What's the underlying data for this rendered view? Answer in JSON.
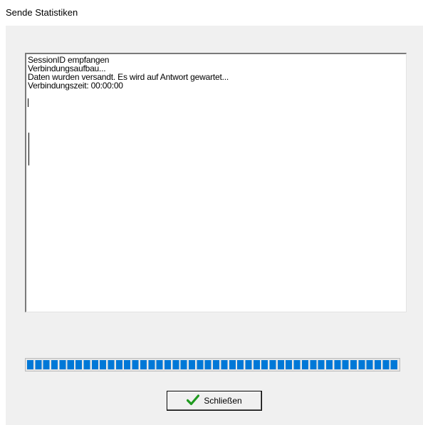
{
  "window": {
    "title": "Sende Statistiken"
  },
  "log": {
    "lines": [
      "SessionID empfangen",
      "Verbindungsaufbau...",
      "Daten wurden versandt. Es wird auf Antwort gewartet...",
      "Verbindungszeit: 00:00:00"
    ]
  },
  "progress": {
    "value_percent": 100,
    "color": "#0078d7"
  },
  "close_button": {
    "label": "Schließen",
    "icon": "checkmark-icon",
    "icon_color": "#1f9a1f"
  }
}
